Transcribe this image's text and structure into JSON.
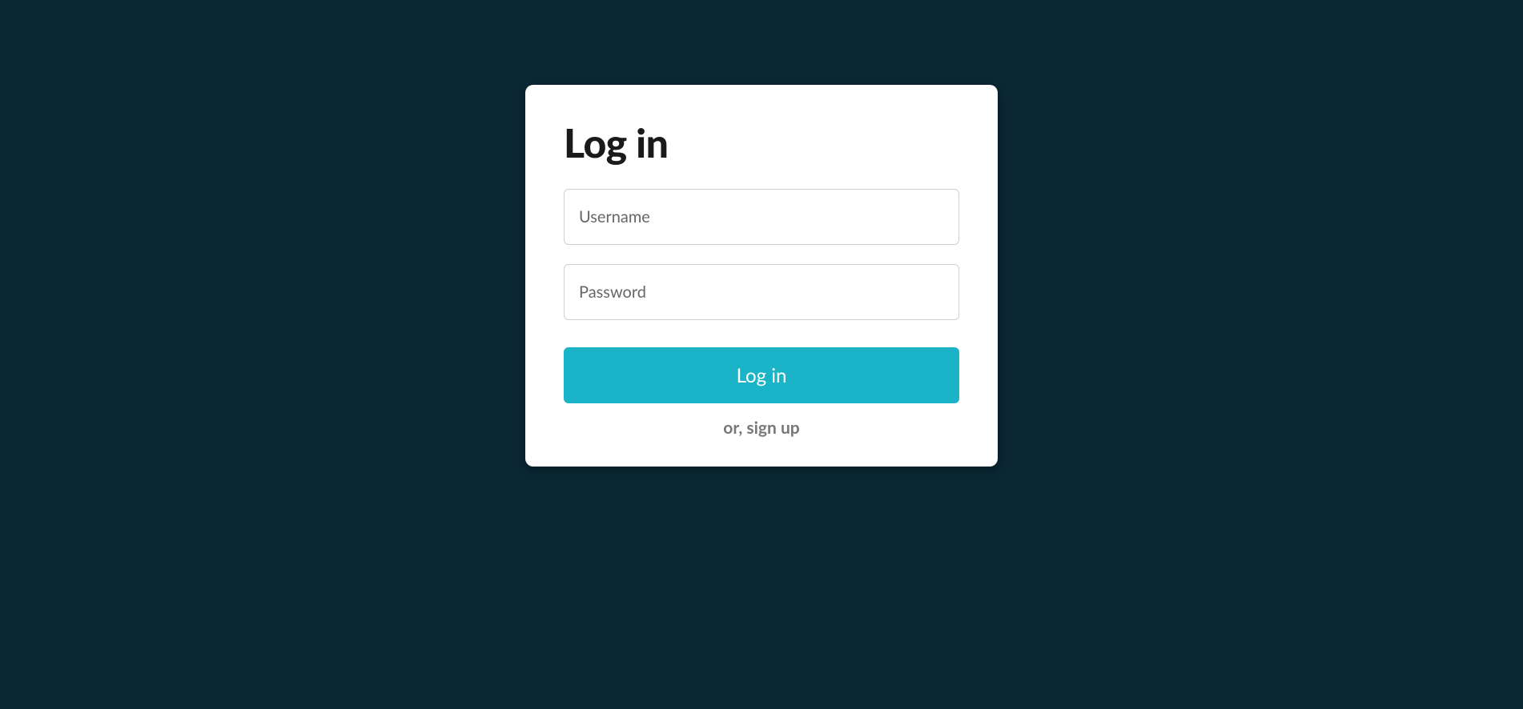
{
  "login": {
    "title": "Log in",
    "username_placeholder": "Username",
    "username_value": "",
    "password_placeholder": "Password",
    "password_value": "",
    "submit_label": "Log in",
    "signup_label": "or, sign up"
  },
  "colors": {
    "background": "#0a2733",
    "card": "#ffffff",
    "accent": "#1bb3c8",
    "text_primary": "#1a1a1a",
    "text_secondary": "#777777",
    "placeholder": "#666666"
  }
}
